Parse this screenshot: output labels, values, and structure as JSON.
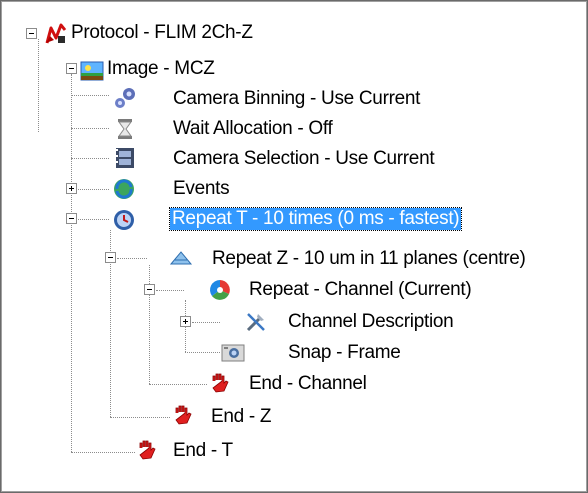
{
  "tree": {
    "nodes": [
      {
        "label": "Protocol - FLIM 2Ch-Z",
        "icon": "protocol-icon",
        "toggle": "minus"
      },
      {
        "label": "Image - MCZ",
        "icon": "image-icon",
        "toggle": "minus"
      },
      {
        "label": "Camera Binning - Use Current",
        "icon": "gears-icon"
      },
      {
        "label": "Wait Allocation - Off",
        "icon": "hourglass-icon"
      },
      {
        "label": "Camera Selection - Use Current",
        "icon": "camera-film-icon"
      },
      {
        "label": "Events",
        "icon": "events-icon",
        "toggle": "plus"
      },
      {
        "label": "Repeat T - 10 times (0 ms - fastest)",
        "icon": "clock-icon",
        "toggle": "minus",
        "selected": true
      },
      {
        "label": "Repeat Z - 10 um in 11 planes (centre)",
        "icon": "pyramid-icon",
        "toggle": "minus"
      },
      {
        "label": "Repeat - Channel (Current)",
        "icon": "color-wheel-icon",
        "toggle": "minus"
      },
      {
        "label": "Channel Description",
        "icon": "tools-icon",
        "toggle": "plus"
      },
      {
        "label": "Snap - Frame",
        "icon": "snapshot-camera-icon"
      },
      {
        "label": "End - Channel",
        "icon": "hand-stop-icon"
      },
      {
        "label": "End - Z",
        "icon": "hand-stop-icon"
      },
      {
        "label": "End - T",
        "icon": "hand-stop-icon"
      }
    ]
  },
  "colors": {
    "selection": "#3399ff",
    "hand": "#e02020"
  }
}
